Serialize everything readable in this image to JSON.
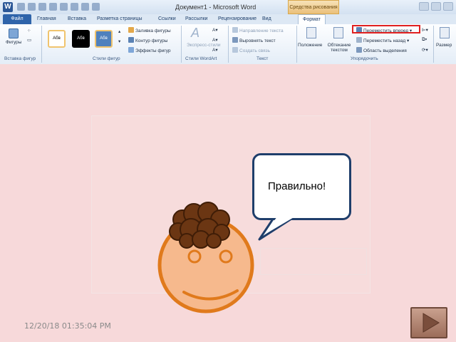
{
  "window": {
    "title": "Документ1 - Microsoft Word",
    "contextual_tools": "Средства рисования"
  },
  "tabs": [
    {
      "label": "Файл"
    },
    {
      "label": "Главная"
    },
    {
      "label": "Вставка"
    },
    {
      "label": "Разметка страницы"
    },
    {
      "label": "Ссылки"
    },
    {
      "label": "Рассылки"
    },
    {
      "label": "Рецензирование"
    },
    {
      "label": "Вид"
    },
    {
      "label": "Формат"
    }
  ],
  "ribbon": {
    "insert_shapes": {
      "shapes_label": "Фигуры",
      "group_label": "Вставка фигур"
    },
    "shape_styles": {
      "samples": [
        "Абв",
        "Абв",
        "Абв"
      ],
      "fill": "Заливка фигуры",
      "outline": "Контур фигуры",
      "effects": "Эффекты фигур",
      "group_label": "Стили фигур"
    },
    "wordart": {
      "express_styles": "Экспресс-стили",
      "group_label": "Стили WordArt"
    },
    "text": {
      "direction": "Направление текста",
      "align": "Выровнять текст",
      "link": "Создать связь",
      "group_label": "Текст"
    },
    "arrange": {
      "position": "Положение",
      "wrap": "Обтекание текстом",
      "bring_forward": "Переместить вперед",
      "send_backward": "Переместить назад",
      "selection_pane": "Область выделения",
      "group_label": "Упорядочить"
    },
    "size": {
      "label": "Размер"
    }
  },
  "slide": {
    "bubble_text": "Правильно!",
    "timestamp": "12/20/18 01:35:04 PM"
  },
  "colors": {
    "background": "#f7d9da",
    "face_fill": "#f6b98d",
    "face_outline": "#e07a1c",
    "hair": "#6b3613",
    "bubble_border": "#1f3e6b",
    "highlight": "#e02020"
  }
}
